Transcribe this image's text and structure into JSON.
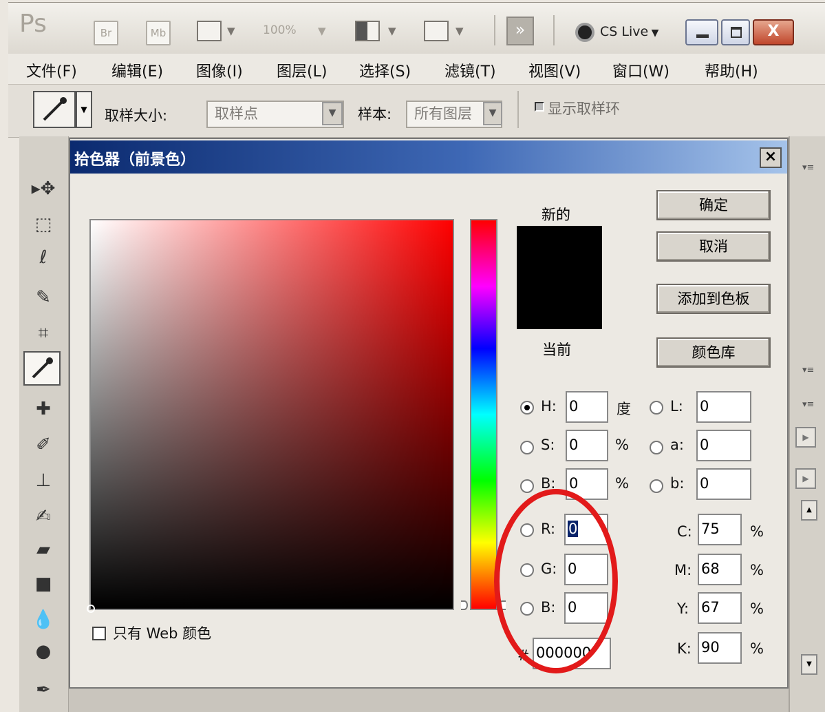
{
  "app": {
    "logo": "Ps",
    "mini_btns": [
      "Br",
      "Mb"
    ],
    "zoom": "100%",
    "cs_live": "CS Live"
  },
  "menu": [
    "文件(F)",
    "编辑(E)",
    "图像(I)",
    "图层(L)",
    "选择(S)",
    "滤镜(T)",
    "视图(V)",
    "窗口(W)",
    "帮助(H)"
  ],
  "options": {
    "sample_size_label": "取样大小:",
    "sample_size_value": "取样点",
    "sample_label": "样本:",
    "sample_value": "所有图层",
    "show_ring_label": "显示取样环"
  },
  "dialog": {
    "title": "拾色器（前景色）",
    "new_label": "新的",
    "current_label": "当前",
    "buttons": [
      "确定",
      "取消",
      "添加到色板",
      "颜色库"
    ],
    "fields": {
      "H": {
        "label": "H:",
        "value": "0",
        "unit": "度"
      },
      "S": {
        "label": "S:",
        "value": "0",
        "unit": "%"
      },
      "B": {
        "label": "B:",
        "value": "0",
        "unit": "%"
      },
      "R": {
        "label": "R:",
        "value": "0"
      },
      "G": {
        "label": "G:",
        "value": "0"
      },
      "Bl": {
        "label": "B:",
        "value": "0"
      },
      "L": {
        "label": "L:",
        "value": "0"
      },
      "a": {
        "label": "a:",
        "value": "0"
      },
      "b": {
        "label": "b:",
        "value": "0"
      },
      "C": {
        "label": "C:",
        "value": "75",
        "unit": "%"
      },
      "M": {
        "label": "M:",
        "value": "68",
        "unit": "%"
      },
      "Y": {
        "label": "Y:",
        "value": "67",
        "unit": "%"
      },
      "K": {
        "label": "K:",
        "value": "90",
        "unit": "%"
      }
    },
    "hex_label": "#",
    "hex_value": "000000",
    "web_only_label": "只有 Web 颜色",
    "selected_mode": "H",
    "new_color": "#000000"
  }
}
